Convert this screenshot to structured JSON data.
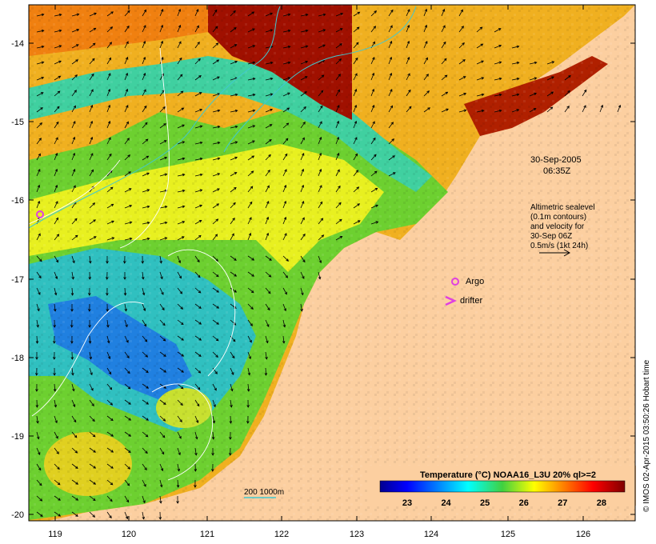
{
  "map": {
    "date": "30-Sep-2005",
    "time": "06:35Z",
    "lon_ticks": [
      "119",
      "120",
      "121",
      "122",
      "123",
      "124",
      "125",
      "126"
    ],
    "lat_ticks": [
      "-14",
      "-15",
      "-16",
      "-17",
      "-18",
      "-19",
      "-20"
    ],
    "annotation": {
      "line1": "Altimetric sealevel",
      "line2": "(0.1m contours)",
      "line3": "and velocity for",
      "line4": "30-Sep 06Z",
      "line5": "0.5m/s (1kt 24h)"
    },
    "legend": {
      "argo": "Argo",
      "drifter": "drifter",
      "argo_color": "#e040e0",
      "drifter_color": "#e040e0"
    },
    "depth_legend": "200  1000m",
    "colorbar": {
      "title": "Temperature (°C) NOAA16_L3U 20% ql>=2",
      "ticks": [
        "23",
        "24",
        "25",
        "26",
        "27",
        "28"
      ],
      "min": 22.3,
      "max": 28.6
    },
    "credit": "© IMOS 02-Apr-2015 03:50:26 Hobart time",
    "colors": {
      "land": "#fccfa0",
      "cold": "#00008f",
      "warm": "#7f0000"
    }
  }
}
